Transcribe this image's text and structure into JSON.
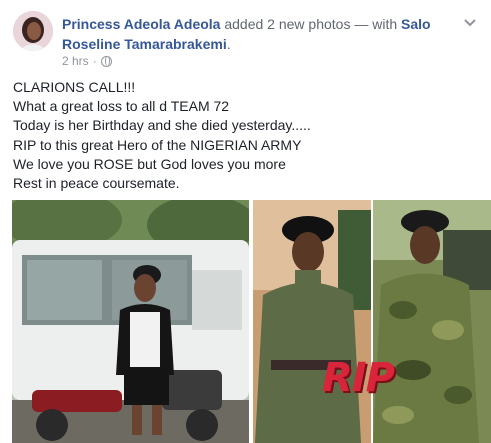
{
  "post": {
    "author": "Princess Adeola Adeola",
    "action": " added 2 new photos — with ",
    "tagged": "Salo Roseline Tamarabrakemi",
    "punct": ".",
    "time": "2 hrs",
    "separator": "·",
    "lines": [
      "CLARIONS CALL!!!",
      "What a great loss to all d TEAM 72",
      "Today is her Birthday and she died yesterday.....",
      "RIP to this great Hero of the NIGERIAN ARMY",
      "We love you ROSE but God loves you more",
      "Rest in peace coursemate."
    ],
    "overlay_text": "RIP"
  },
  "icons": {
    "privacy": "globe-icon",
    "options": "chevron-down-icon"
  },
  "colors": {
    "link": "#365899",
    "meta": "#90949c",
    "text": "#1d2129",
    "rip": "#d9253a"
  }
}
